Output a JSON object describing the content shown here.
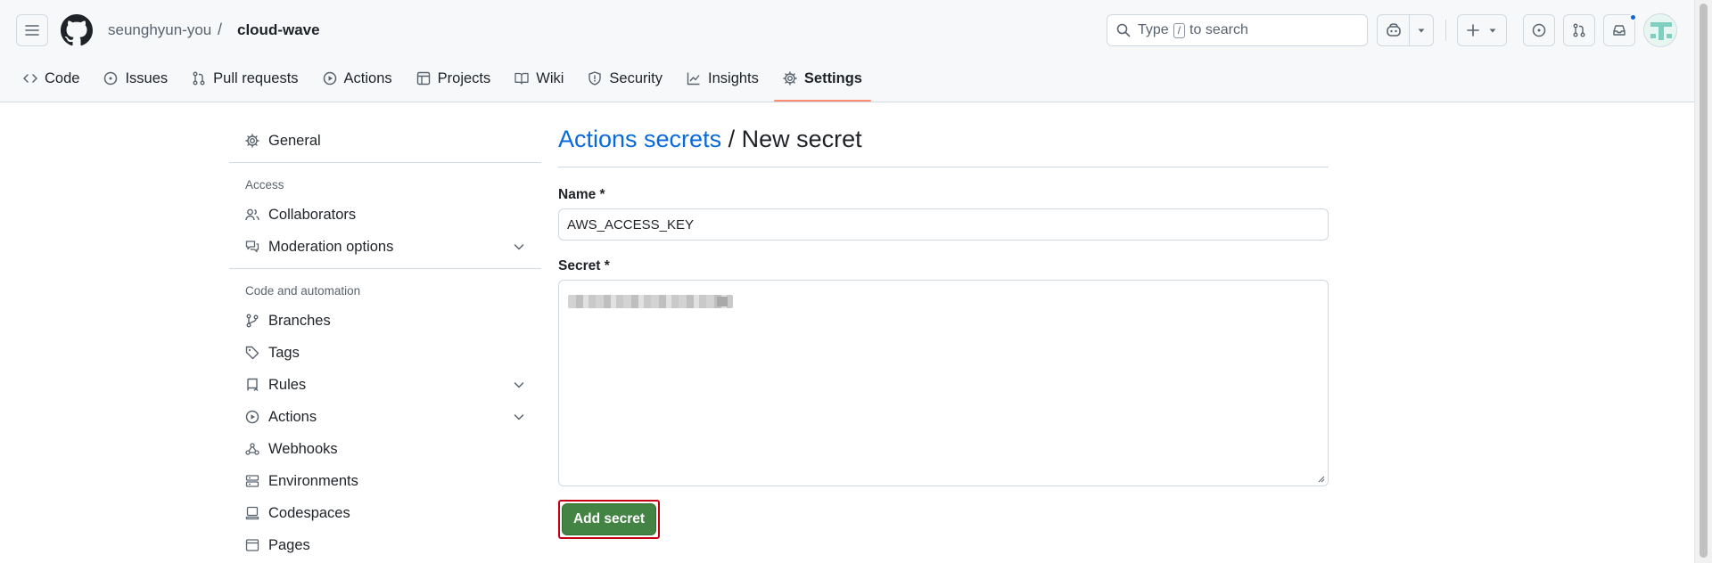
{
  "header": {
    "owner": "seunghyun-you",
    "separator": "/",
    "repo": "cloud-wave",
    "search": {
      "prefix": "Type",
      "shortcut": "/",
      "suffix": "to search"
    },
    "icons": [
      "hamburger-icon",
      "github-logo-icon",
      "search-icon",
      "copilot-icon",
      "plus-icon",
      "issues-icon",
      "pull-request-icon",
      "inbox-icon"
    ]
  },
  "repo_nav": {
    "items": [
      {
        "label": "Code",
        "icon": "code-icon"
      },
      {
        "label": "Issues",
        "icon": "issues-icon"
      },
      {
        "label": "Pull requests",
        "icon": "pull-request-icon"
      },
      {
        "label": "Actions",
        "icon": "actions-icon"
      },
      {
        "label": "Projects",
        "icon": "projects-icon"
      },
      {
        "label": "Wiki",
        "icon": "wiki-icon"
      },
      {
        "label": "Security",
        "icon": "shield-icon"
      },
      {
        "label": "Insights",
        "icon": "graph-icon"
      },
      {
        "label": "Settings",
        "icon": "gear-icon",
        "selected": true
      }
    ]
  },
  "sidebar": {
    "general": "General",
    "access_heading": "Access",
    "access_items": [
      {
        "label": "Collaborators",
        "icon": "people-icon"
      },
      {
        "label": "Moderation options",
        "icon": "comment-discussion-icon",
        "expandable": true
      }
    ],
    "code_heading": "Code and automation",
    "code_items": [
      {
        "label": "Branches",
        "icon": "branch-icon"
      },
      {
        "label": "Tags",
        "icon": "tag-icon"
      },
      {
        "label": "Rules",
        "icon": "repo-push-icon",
        "expandable": true
      },
      {
        "label": "Actions",
        "icon": "play-icon",
        "expandable": true
      },
      {
        "label": "Webhooks",
        "icon": "webhook-icon"
      },
      {
        "label": "Environments",
        "icon": "server-icon"
      },
      {
        "label": "Codespaces",
        "icon": "codespaces-icon"
      },
      {
        "label": "Pages",
        "icon": "browser-icon"
      }
    ]
  },
  "main": {
    "title_link": "Actions secrets",
    "title_rest": " / New secret",
    "name_label": "Name *",
    "name_value": "AWS_ACCESS_KEY",
    "secret_label": "Secret *",
    "submit_label": "Add secret"
  },
  "colors": {
    "link": "#0969da",
    "submit_bg": "#438343",
    "highlight_border": "#c40012",
    "selected_tab_underline": "#fd8c73"
  }
}
